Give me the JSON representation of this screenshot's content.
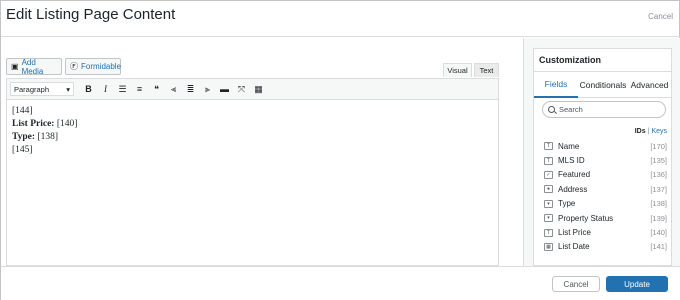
{
  "header": {
    "title": "Edit Listing Page Content",
    "cancel_label": "Cancel"
  },
  "editor": {
    "add_media_label": "Add Media",
    "formidable_label": "Formidable",
    "tabs": {
      "visual": "Visual",
      "text": "Text"
    },
    "format_select": "Paragraph",
    "toolbar_icons": [
      "bold-icon",
      "italic-icon",
      "bullet-list-icon",
      "numbered-list-icon",
      "blockquote-icon",
      "align-left-icon",
      "align-center-icon",
      "align-right-icon",
      "horizontal-rule-icon",
      "fullscreen-icon",
      "toolbar-toggle-icon"
    ],
    "content": {
      "line1": "[144]",
      "line2_label": "List Price:",
      "line2_value": " [140]",
      "line3_label": "Type:",
      "line3_value": " [138]",
      "line4": "[145]"
    }
  },
  "sidebar": {
    "title": "Customization",
    "tabs": {
      "fields": "Fields",
      "conditionals": "Conditionals",
      "advanced": "Advanced"
    },
    "search_placeholder": "Search",
    "ids_label": "IDs",
    "separator": "|",
    "keys_label": "Keys",
    "fields": [
      {
        "name": "Name",
        "id": "[170]",
        "icon": "text-field-icon"
      },
      {
        "name": "MLS ID",
        "id": "[135]",
        "icon": "text-field-icon"
      },
      {
        "name": "Featured",
        "id": "[136]",
        "icon": "checkbox-field-icon"
      },
      {
        "name": "Address",
        "id": "[137]",
        "icon": "location-pin-icon"
      },
      {
        "name": "Type",
        "id": "[138]",
        "icon": "dropdown-field-icon"
      },
      {
        "name": "Property Status",
        "id": "[139]",
        "icon": "dropdown-field-icon"
      },
      {
        "name": "List Price",
        "id": "[140]",
        "icon": "text-field-icon"
      },
      {
        "name": "List Date",
        "id": "[141]",
        "icon": "calendar-icon"
      }
    ]
  },
  "footer": {
    "cancel_label": "Cancel",
    "update_label": "Update"
  },
  "colors": {
    "accent": "#2271b1",
    "border": "#dcdcde",
    "text": "#1d2327"
  }
}
